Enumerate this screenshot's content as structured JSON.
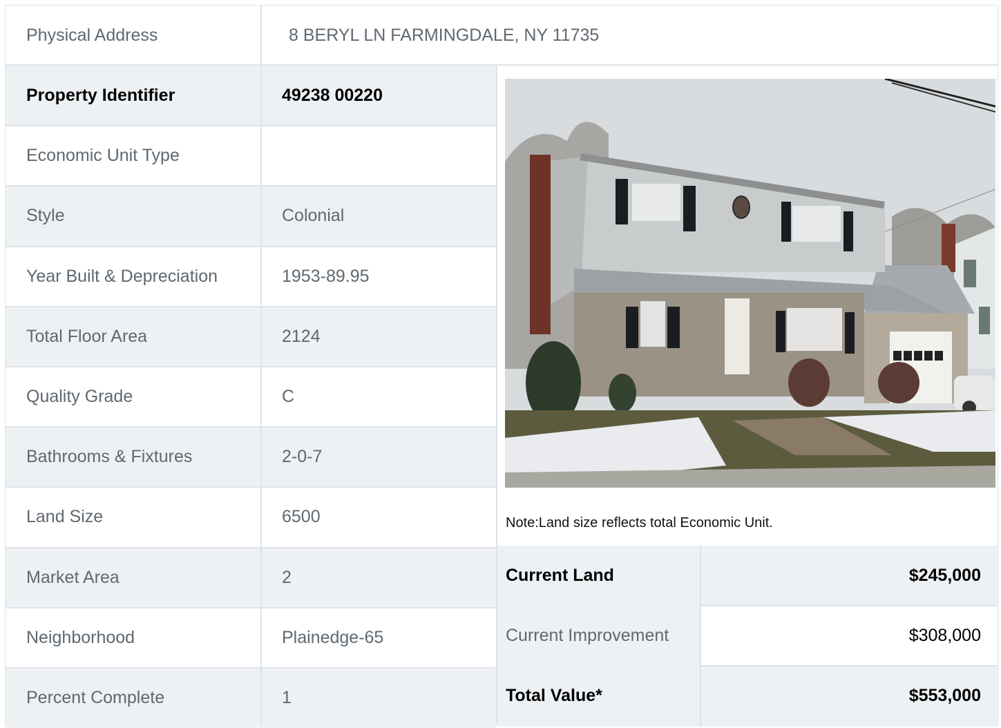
{
  "address": {
    "label": "Physical Address",
    "value": "8  BERYL LN  FARMINGDALE, NY  11735"
  },
  "rows": [
    {
      "label": "Property Identifier",
      "value": "49238  00220",
      "bold": true
    },
    {
      "label": "Economic Unit Type",
      "value": ""
    },
    {
      "label": "Style",
      "value": "Colonial"
    },
    {
      "label": "Year Built & Depreciation",
      "value": "1953-89.95"
    },
    {
      "label": "Total Floor Area",
      "value": "2124"
    },
    {
      "label": "Quality Grade",
      "value": "C"
    },
    {
      "label": "Bathrooms & Fixtures",
      "value": "2-0-7"
    },
    {
      "label": "Land Size",
      "value": "6500"
    },
    {
      "label": "Market Area",
      "value": "2"
    },
    {
      "label": "Neighborhood",
      "value": "Plainedge-65"
    },
    {
      "label": "Percent Complete",
      "value": "1"
    }
  ],
  "note": "Note:Land size reflects total Economic Unit.",
  "values": [
    {
      "label": "Current Land",
      "value": "$245,000",
      "bold": true
    },
    {
      "label": "Current Improvement",
      "value": "$308,000",
      "bold": false
    },
    {
      "label": "Total Value*",
      "value": "$553,000",
      "bold": true
    }
  ],
  "colors": {
    "alt_row": "#eef1f4",
    "border": "#dfe3e7",
    "muted_text": "#5f6870"
  }
}
